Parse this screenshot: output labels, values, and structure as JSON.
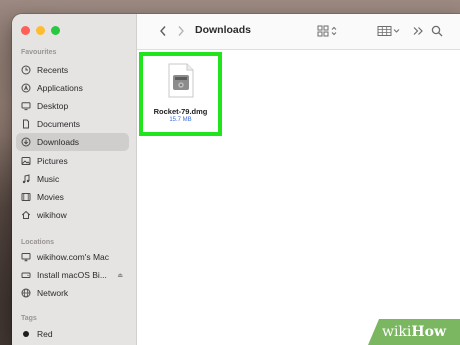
{
  "window": {
    "title": "Downloads"
  },
  "sidebar": {
    "sections": {
      "favourites": "Favourites",
      "locations": "Locations",
      "tags": "Tags"
    },
    "favourites": [
      {
        "label": "Recents",
        "icon": "clock-icon"
      },
      {
        "label": "Applications",
        "icon": "applications-icon"
      },
      {
        "label": "Desktop",
        "icon": "desktop-icon"
      },
      {
        "label": "Documents",
        "icon": "document-icon"
      },
      {
        "label": "Downloads",
        "icon": "download-icon",
        "selected": true
      },
      {
        "label": "Pictures",
        "icon": "pictures-icon"
      },
      {
        "label": "Music",
        "icon": "music-icon"
      },
      {
        "label": "Movies",
        "icon": "movies-icon"
      },
      {
        "label": "wikihow",
        "icon": "home-icon"
      }
    ],
    "locations": [
      {
        "label": "wikihow.com's Mac",
        "icon": "computer-icon"
      },
      {
        "label": "Install macOS Bi...",
        "icon": "disk-icon"
      },
      {
        "label": "Network",
        "icon": "network-icon"
      }
    ],
    "tags": [
      {
        "label": "Red",
        "icon": "tag-dot"
      }
    ]
  },
  "files": [
    {
      "name": "Rocket-79.dmg",
      "size": "15.7 MB",
      "icon": "disk-image-icon"
    }
  ],
  "watermark": {
    "prefix": "wiki",
    "suffix": "How"
  },
  "colors": {
    "highlight": "#22e41c",
    "size_text": "#3d6fd6"
  }
}
